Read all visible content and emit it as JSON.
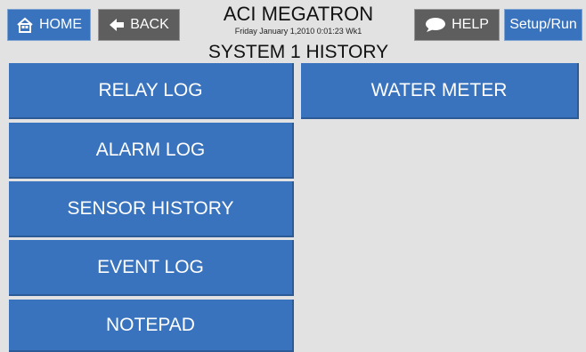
{
  "header": {
    "home_label": "HOME",
    "back_label": "BACK",
    "help_label": "HELP",
    "setup_label": "Setup/Run",
    "app_title": "ACI MEGATRON",
    "datetime": "Friday January 1,2010 0:01:23 Wk1",
    "page_title": "SYSTEM 1 HISTORY"
  },
  "menu": {
    "left": [
      "RELAY LOG",
      "ALARM LOG",
      "SENSOR HISTORY",
      "EVENT LOG",
      "NOTEPAD"
    ],
    "right": [
      "WATER METER"
    ]
  },
  "colors": {
    "accent": "#3a73bd",
    "dark_button": "#5e5e5e",
    "background": "#e2e2e2"
  },
  "icons": {
    "home": "home-icon",
    "back": "back-arrow-icon",
    "help": "speech-bubble-icon"
  }
}
